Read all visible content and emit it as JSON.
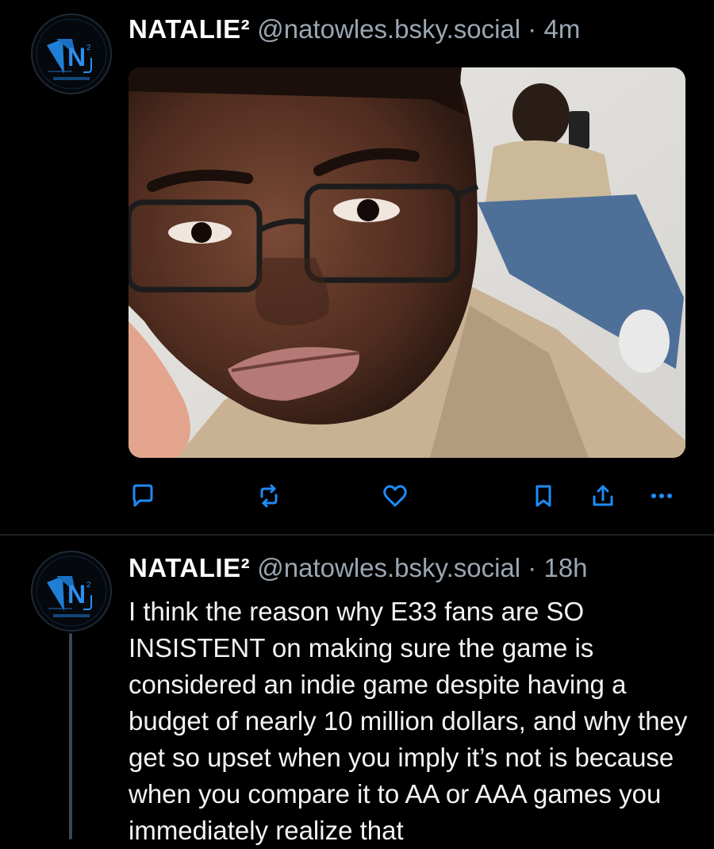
{
  "posts": [
    {
      "author": {
        "display_name": "NATALIE²",
        "handle": "@natowles.bsky.social",
        "avatar_icon": "natalie-n-logo-avatar"
      },
      "separator": "·",
      "time": "4m",
      "media": {
        "type": "image",
        "description_icon": "selfie-photo"
      },
      "actions": {
        "reply_icon": "reply-icon",
        "repost_icon": "repost-icon",
        "like_icon": "heart-icon",
        "bookmark_icon": "bookmark-icon",
        "share_icon": "share-icon",
        "more_icon": "more-icon"
      }
    },
    {
      "author": {
        "display_name": "NATALIE²",
        "handle": "@natowles.bsky.social",
        "avatar_icon": "natalie-n-logo-avatar"
      },
      "separator": "·",
      "time": "18h",
      "text": "I think the reason why E33 fans are SO INSISTENT on making sure the game is considered an indie game despite having a budget of nearly 10 million dollars, and why they get so upset when you imply it’s not is because when you compare it to AA or AAA games you immediately realize that"
    }
  ],
  "colors": {
    "background": "#000000",
    "text": "#ffffff",
    "muted": "#9aa6b2",
    "action": "#1d8cf8",
    "divider": "#1c2127"
  }
}
